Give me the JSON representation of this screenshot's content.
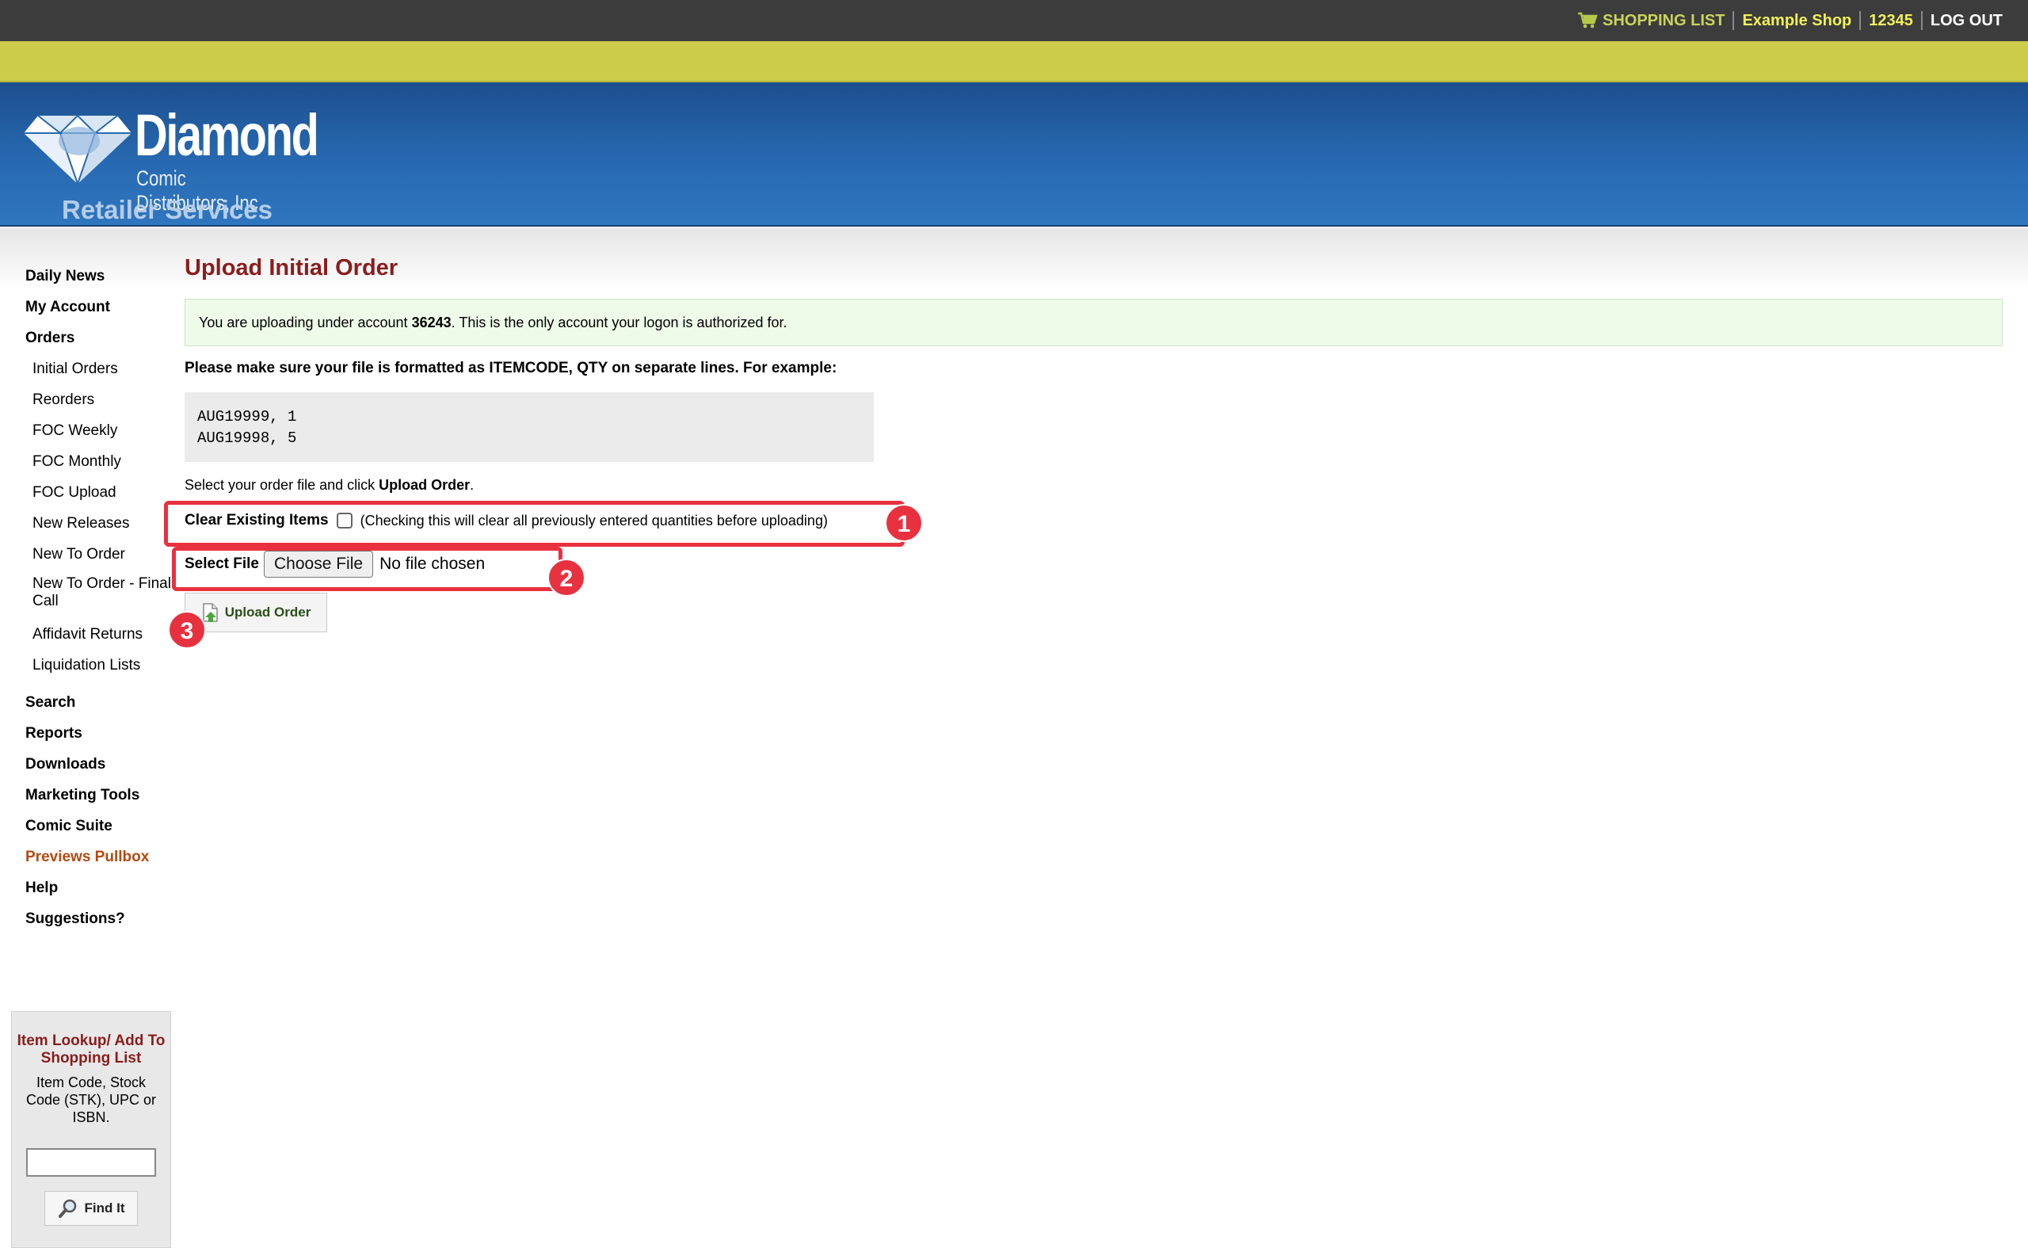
{
  "topnav": {
    "shopping_list": "SHOPPING LIST",
    "shop_name": "Example Shop",
    "account_number": "12345",
    "logout": "LOG OUT"
  },
  "logo": {
    "word": "Diamond",
    "sub": "Comic Distributors, Inc.",
    "tagline": "Retailer Services"
  },
  "sidebar": {
    "items": [
      {
        "label": "Daily News"
      },
      {
        "label": "My Account"
      },
      {
        "label": "Orders"
      }
    ],
    "orders_sub": [
      {
        "label": "Initial Orders"
      },
      {
        "label": "Reorders"
      },
      {
        "label": "FOC Weekly"
      },
      {
        "label": "FOC Monthly"
      },
      {
        "label": "FOC Upload"
      },
      {
        "label": "New Releases"
      },
      {
        "label": "New To Order"
      },
      {
        "label": "New To Order - Final Call"
      },
      {
        "label": "Affidavit Returns"
      },
      {
        "label": "Liquidation Lists"
      }
    ],
    "items_after": [
      {
        "label": "Search"
      },
      {
        "label": "Reports"
      },
      {
        "label": "Downloads"
      },
      {
        "label": "Marketing Tools"
      },
      {
        "label": "Comic Suite"
      },
      {
        "label": "Previews Pullbox"
      },
      {
        "label": "Help"
      },
      {
        "label": "Suggestions?"
      }
    ]
  },
  "lookup": {
    "title": "Item Lookup/ Add To Shopping List",
    "description": "Item Code, Stock Code (STK), UPC or ISBN.",
    "input_value": "",
    "button": "Find It"
  },
  "main": {
    "title": "Upload Initial Order",
    "notice_prefix": "You are uploading under account",
    "notice_account": "36243",
    "notice_suffix": ". This is the only account your logon is authorized for.",
    "instruction": "Please make sure your file is formatted as ITEMCODE, QTY on separate lines. For example:",
    "example_lines": [
      "AUG19999, 1",
      "AUG19998, 5"
    ],
    "select_prefix": "Select your order file and click",
    "select_bold": "Upload Order",
    "select_suffix": ".",
    "clear_label": "Clear Existing Items",
    "clear_note": "(Checking this will clear all previously entered quantities before uploading)",
    "file_label": "Select File",
    "choose_file": "Choose File",
    "no_file": "No file chosen",
    "upload_button": "Upload Order"
  },
  "annotations": [
    "1",
    "2",
    "3"
  ],
  "colors": {
    "accent_red": "#e8313f",
    "title_red": "#8a1d1d",
    "header_blue": "#2769b0",
    "band_yellow": "#cccc4a"
  }
}
